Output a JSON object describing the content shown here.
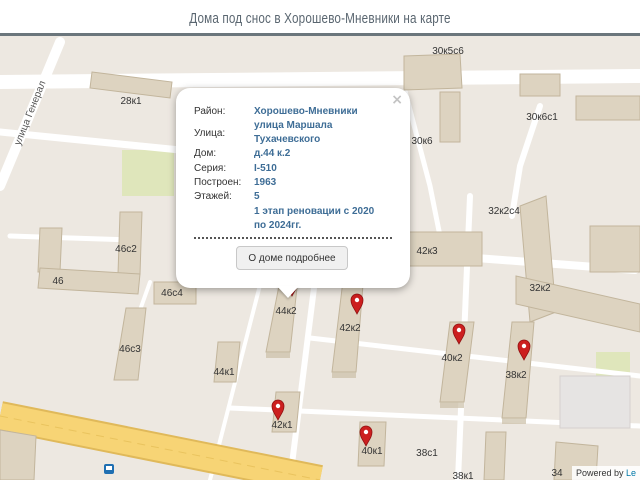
{
  "page": {
    "title": "Дома под снос в Хорошево-Мневники на карте"
  },
  "map": {
    "street_label": "улица Генерал",
    "buildings": [
      "28к1",
      "30к5с6",
      "30к6",
      "30к6с1",
      "32к2с4",
      "46с2",
      "46",
      "46с4",
      "46с3",
      "44к2",
      "42к3",
      "32к2",
      "42к2",
      "40к2",
      "38к2",
      "44к1",
      "42к1",
      "40к1",
      "38с1",
      "38к1",
      "34"
    ],
    "markers": [
      "44к2",
      "42к2",
      "40к2",
      "38к2",
      "42к1",
      "40к1"
    ],
    "colors": {
      "ground": "#ede8e1",
      "road": "#ffffff",
      "building": "#ddd3c0",
      "marker": "#cc1f1f",
      "highway": "#f7d475",
      "park": "#dfe6bb"
    },
    "attribution": {
      "text": "Powered by",
      "link": "Le"
    }
  },
  "popup": {
    "district_label": "Район:",
    "district_value": "Хорошево-Мневники",
    "street_label": "Улица:",
    "street_value_line1": "улица Маршала",
    "street_value_line2": "Тухачевского",
    "house_label": "Дом:",
    "house_value": "д.44 к.2",
    "series_label": "Серия:",
    "series_value": "I-510",
    "built_label": "Построен:",
    "built_value": "1963",
    "floors_label": "Этажей:",
    "floors_value": "5",
    "stage_line1": "1 этап реновации с 2020",
    "stage_line2": "по 2024гг.",
    "button_label": "О доме подробнее",
    "close_symbol": "×"
  }
}
